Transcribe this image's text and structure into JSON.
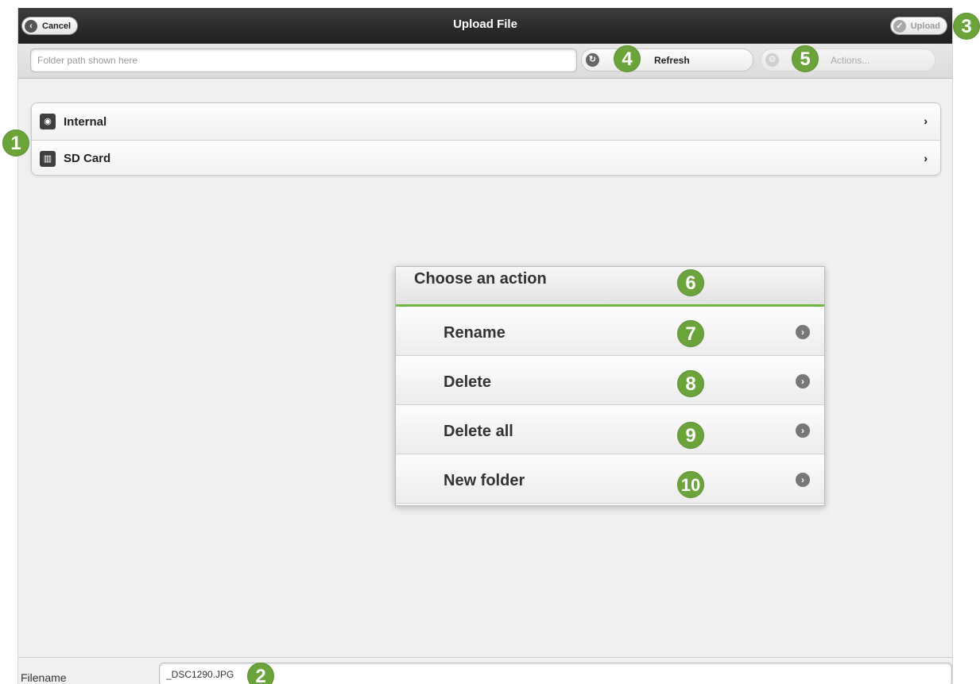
{
  "header": {
    "title": "Upload File",
    "cancel_label": "Cancel",
    "upload_label": "Upload"
  },
  "toolbar": {
    "path_placeholder": "Folder path shown here",
    "refresh_label": "Refresh",
    "actions_label": "Actions..."
  },
  "storage_list": [
    {
      "label": "Internal",
      "icon": "hard-drive-icon"
    },
    {
      "label": "SD Card",
      "icon": "sd-card-icon"
    }
  ],
  "action_popup": {
    "title": "Choose an action",
    "items": [
      {
        "label": "Rename"
      },
      {
        "label": "Delete"
      },
      {
        "label": "Delete all"
      },
      {
        "label": "New folder"
      }
    ]
  },
  "footer": {
    "filename_label": "Filename",
    "filename_value": "_DSC1290.JPG"
  },
  "markers": [
    "1",
    "2",
    "3",
    "4",
    "5",
    "6",
    "7",
    "8",
    "9",
    "10"
  ],
  "colors": {
    "marker": "#6aa43a",
    "header_bg": "#2a2a2a",
    "popup_accent": "#6fb944"
  }
}
